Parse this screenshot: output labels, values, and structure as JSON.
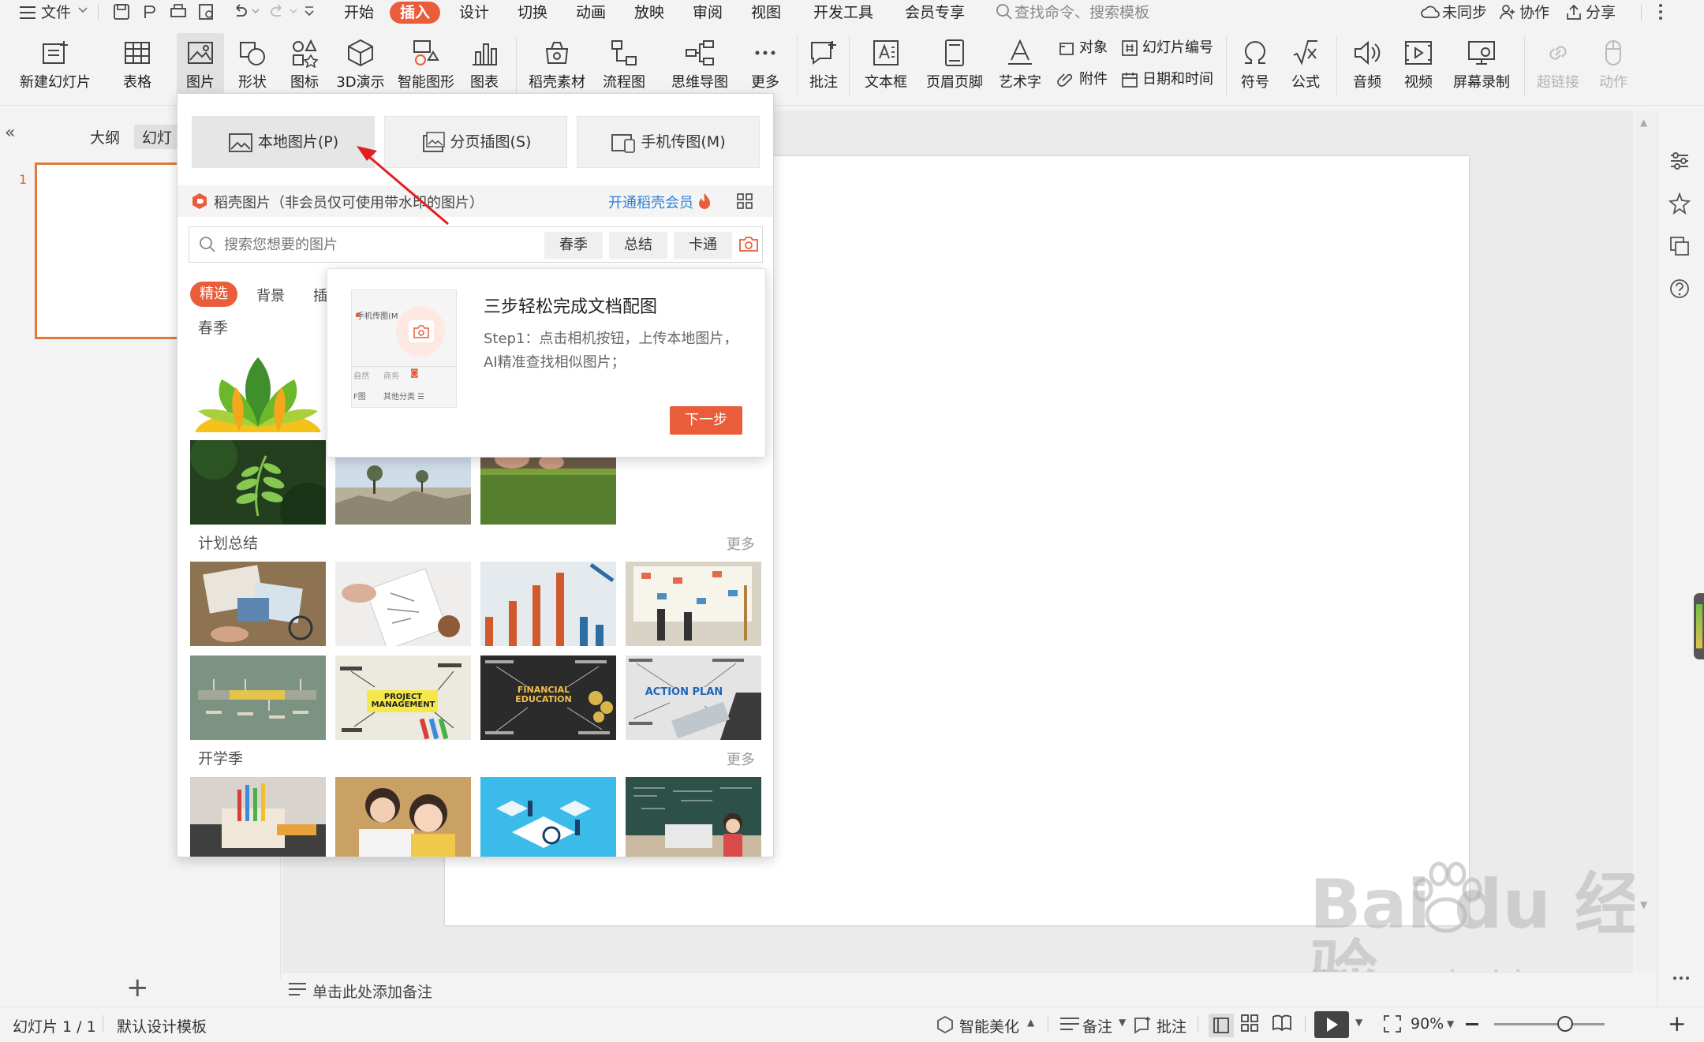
{
  "menubar": {
    "file": "文件",
    "tabs": [
      "开始",
      "插入",
      "设计",
      "切换",
      "动画",
      "放映",
      "审阅",
      "视图",
      "开发工具",
      "会员专享"
    ],
    "active_tab": "插入",
    "search_placeholder": "查找命令、搜索模板",
    "sync": "未同步",
    "collab": "协作",
    "share": "分享"
  },
  "ribbon": {
    "new_slide": "新建幻灯片",
    "table": "表格",
    "picture": "图片",
    "shape": "形状",
    "icon": "图标",
    "three_d": "3D演示",
    "smart_art": "智能图形",
    "chart": "图表",
    "daoke": "稻壳素材",
    "flowchart": "流程图",
    "mindmap": "思维导图",
    "more": "更多",
    "comment": "批注",
    "textbox": "文本框",
    "header_footer": "页眉页脚",
    "wordart": "艺术字",
    "object": "对象",
    "slide_number": "幻灯片编号",
    "attachment": "附件",
    "datetime": "日期和时间",
    "symbol": "符号",
    "formula": "公式",
    "audio": "音频",
    "video": "视频",
    "screen_record": "屏幕录制",
    "hyperlink": "超链接",
    "action": "动作"
  },
  "leftpanel": {
    "outline_tab": "大纲",
    "slides_tab": "幻灯",
    "slide_number": "1"
  },
  "dropdown": {
    "options": [
      "本地图片(P)",
      "分页插图(S)",
      "手机传图(M)"
    ],
    "banner_text": "稻壳图片（非会员仅可使用带水印的图片）",
    "member_link": "开通稻壳会员",
    "search_placeholder": "搜索您想要的图片",
    "search_tags": [
      "春季",
      "总结",
      "卡通"
    ],
    "categories": [
      "精选",
      "背景",
      "插"
    ],
    "sections": [
      {
        "title": "春季",
        "more": ""
      },
      {
        "title": "计划总结",
        "more": "更多"
      },
      {
        "title": "开学季",
        "more": "更多"
      }
    ],
    "thumb_text": {
      "project": "PROJECT MANAGEMENT",
      "financial": "FINANCIAL EDUCATION",
      "action": "ACTION PLAN"
    }
  },
  "tooltip": {
    "title": "三步轻松完成文档配图",
    "body_line1": "Step1：点击相机按钮，上传本地图片，",
    "body_line2": "AI精准查找相似图片；",
    "next_button": "下一步",
    "mini_label": "手机传图(M",
    "mini_tags": [
      "自然",
      "商务"
    ],
    "mini_label2": "F图",
    "mini_label3": "其他分类 ☰"
  },
  "notes": {
    "placeholder": "单击此处添加备注"
  },
  "status": {
    "slide_info": "幻灯片 1 / 1",
    "template": "默认设计模板",
    "beautify": "智能美化",
    "notes": "备注",
    "comment": "批注",
    "zoom": "90%"
  },
  "watermark": {
    "brand": "Bai du 经验",
    "url": "jingyan.baidu.com"
  },
  "colors": {
    "accent": "#e95d3a",
    "link": "#2f7fd6"
  }
}
